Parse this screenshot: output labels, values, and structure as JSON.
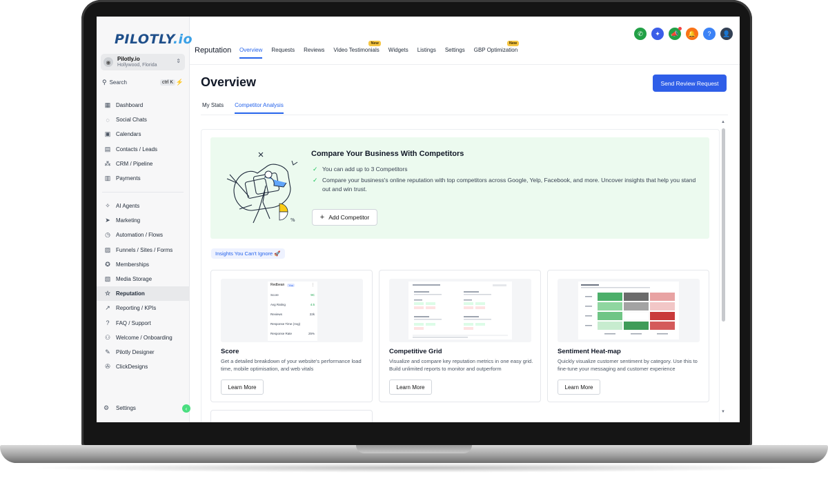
{
  "brand": {
    "logo_main": "PILOTLY",
    "logo_suffix": ".io"
  },
  "account": {
    "name": "Pilotly.io",
    "location": "Hollywood, Florida"
  },
  "search": {
    "label": "Search",
    "shortcut": "ctrl K"
  },
  "sidebar": {
    "group1": [
      {
        "label": "Dashboard",
        "icon": "dashboard-icon"
      },
      {
        "label": "Social Chats",
        "icon": "chat-icon"
      },
      {
        "label": "Calendars",
        "icon": "calendar-icon"
      },
      {
        "label": "Contacts / Leads",
        "icon": "contacts-icon"
      },
      {
        "label": "CRM / Pipeline",
        "icon": "pipeline-icon"
      },
      {
        "label": "Payments",
        "icon": "payments-icon"
      }
    ],
    "group2": [
      {
        "label": "AI Agents",
        "icon": "sparkle-icon"
      },
      {
        "label": "Marketing",
        "icon": "send-icon"
      },
      {
        "label": "Automation / Flows",
        "icon": "automation-icon"
      },
      {
        "label": "Funnels / Sites / Forms",
        "icon": "funnels-icon"
      },
      {
        "label": "Memberships",
        "icon": "membership-icon"
      },
      {
        "label": "Media Storage",
        "icon": "image-icon"
      },
      {
        "label": "Reputation",
        "icon": "star-icon",
        "active": true
      },
      {
        "label": "Reporting / KPIs",
        "icon": "chart-line-icon"
      },
      {
        "label": "FAQ / Support",
        "icon": "question-icon"
      },
      {
        "label": "Welcome / Onboarding",
        "icon": "users-icon"
      },
      {
        "label": "Pilotly Designer",
        "icon": "brush-icon"
      },
      {
        "label": "ClickDesigns",
        "icon": "wrench-icon"
      }
    ],
    "settings_label": "Settings"
  },
  "topbar": {
    "section_title": "Reputation",
    "tabs": [
      {
        "label": "Overview",
        "active": true
      },
      {
        "label": "Requests"
      },
      {
        "label": "Reviews"
      },
      {
        "label": "Video Testimonials",
        "badge": "New"
      },
      {
        "label": "Widgets"
      },
      {
        "label": "Listings"
      },
      {
        "label": "Settings"
      },
      {
        "label": "GBP Optimization",
        "badge": "New"
      }
    ],
    "icon_colors": {
      "phone": "#22a046",
      "magic": "#3b5ee8",
      "megaphone": "#22a046",
      "bell": "#f97316",
      "help": "#3b82f6"
    }
  },
  "main": {
    "page_title": "Overview",
    "primary_button": "Send Review Request",
    "subtabs": [
      {
        "label": "My Stats"
      },
      {
        "label": "Competitor Analysis",
        "active": true
      }
    ],
    "hero": {
      "title": "Compare Your Business With Competitors",
      "points": [
        "You can add up to 3 Competitors",
        "Compare your business's online reputation with top competitors across Google, Yelp, Facebook, and more. Uncover insights that help you stand out and win trust."
      ],
      "button": "Add Competitor"
    },
    "insights_tag": "Insights You Can't Ignore 🚀",
    "cards": [
      {
        "title": "Score",
        "desc": "Get a detailed breakdown of your website's performance load time, mobile optimisation, and web vitals",
        "button": "Learn More",
        "preview": {
          "business": "Redbean",
          "you": "You",
          "rows": [
            {
              "k": "Score",
              "v": "9C"
            },
            {
              "k": "Avg Rating",
              "v": "4.5"
            },
            {
              "k": "Reviews",
              "v": "22k"
            },
            {
              "k": "Response Time (Avg)",
              "v": ""
            },
            {
              "k": "Response Rate",
              "v": "25%"
            }
          ]
        }
      },
      {
        "title": "Competitive Grid",
        "desc": "Visualize and compare key reputation metrics in one easy grid. Build unlimited reports to monitor and outperform",
        "button": "Learn More"
      },
      {
        "title": "Sentiment Heat-map",
        "desc": "Quickly visualize customer sentiment by category. Use this to fine-tune your messaging and customer experience",
        "button": "Learn More"
      }
    ]
  }
}
